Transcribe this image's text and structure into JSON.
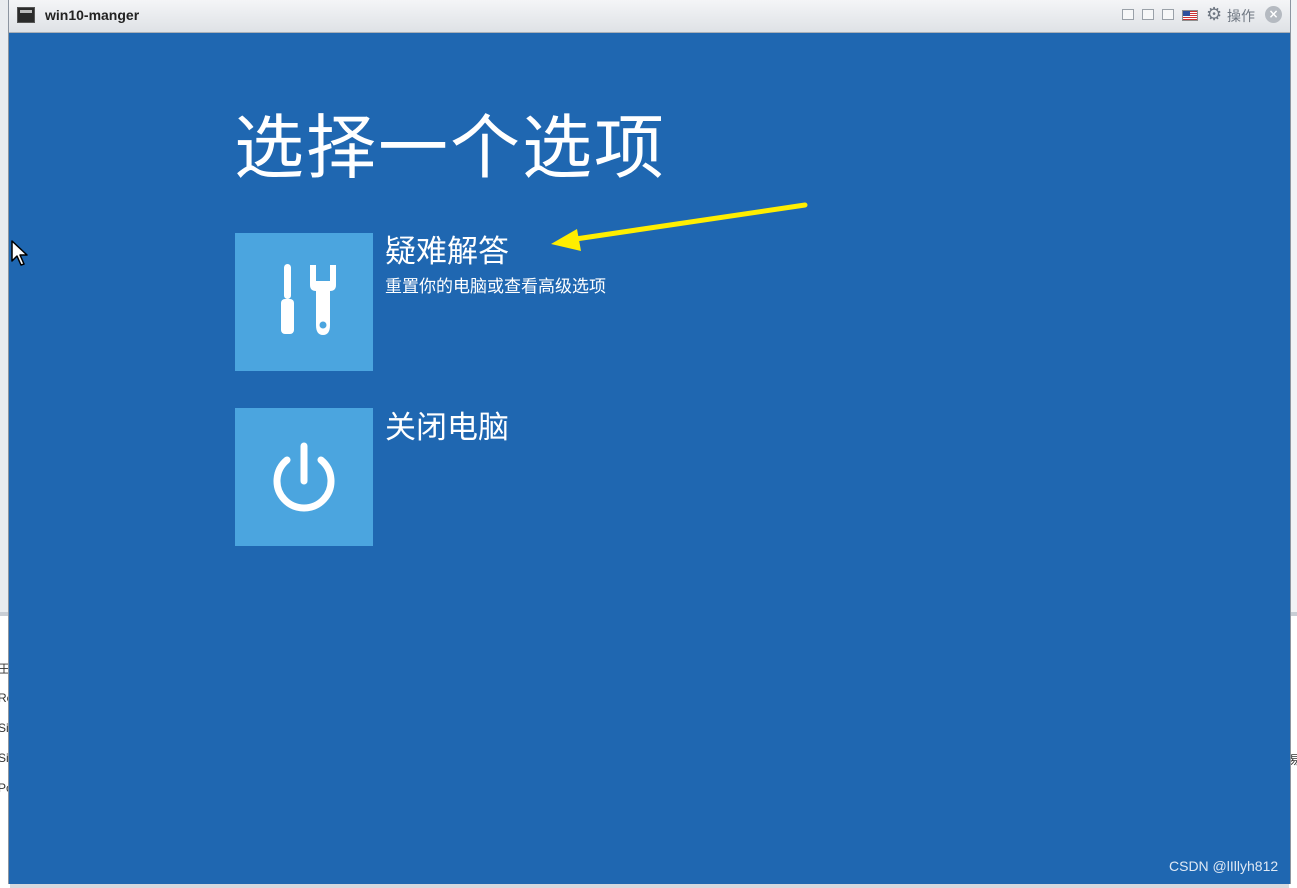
{
  "window": {
    "title": "win10-manger",
    "ops_label": "操作",
    "close_glyph": "×"
  },
  "screen": {
    "heading": "选择一个选项",
    "options": [
      {
        "title": "疑难解答",
        "description": "重置你的电脑或查看高级选项",
        "icon": "tools-icon"
      },
      {
        "title": "关闭电脑",
        "icon": "power-icon"
      }
    ]
  },
  "background_fragments": [
    "王",
    "Re",
    "Si",
    "Si",
    "Pc",
    "易"
  ],
  "watermark": "CSDN @lIllyh812",
  "colors": {
    "screen_bg": "#1f67b1",
    "tile_bg": "#4ba5df",
    "annotation_arrow": "#ffee00"
  }
}
